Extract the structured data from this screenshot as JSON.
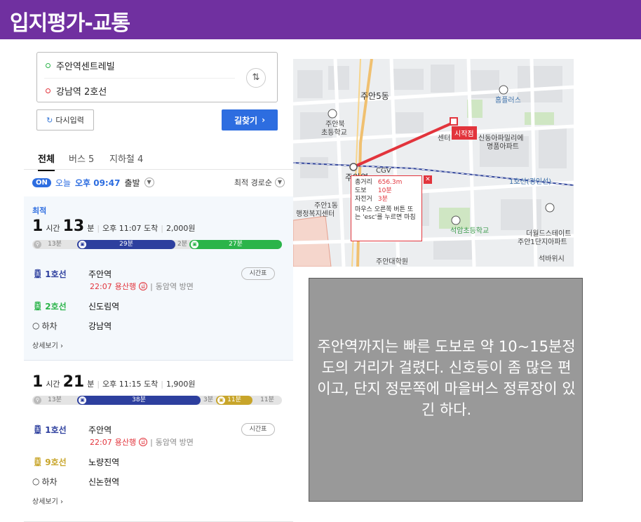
{
  "page": {
    "title": "입지평가-교통"
  },
  "search": {
    "origin": "주안역센트레빌",
    "destination": "강남역 2호선",
    "reset_label": "다시입력",
    "find_label": "길찾기"
  },
  "tabs": [
    {
      "label": "전체"
    },
    {
      "label": "버스 5"
    },
    {
      "label": "지하철 4"
    }
  ],
  "depart": {
    "on_badge": "ON",
    "today": "오늘",
    "time": "오후 09:47",
    "suffix": "출발",
    "sort_label": "최적 경로순"
  },
  "routes": [
    {
      "badge": "최적",
      "hours": "1",
      "hours_unit": "시간",
      "minutes": "13",
      "minutes_unit": "분",
      "arrival": "오후 11:07 도착",
      "fare": "2,000원",
      "segments": [
        {
          "label": "13분",
          "mode": "walk"
        },
        {
          "label": "29분",
          "mode": "line1"
        },
        {
          "label": "2분",
          "mode": "walk"
        },
        {
          "label": "27분",
          "mode": "line2"
        }
      ],
      "legs": [
        {
          "line": "1호선",
          "station": "주안역",
          "color": "#2d3f9e",
          "sub_time": "22:07",
          "sub_dir": "용산행",
          "sub_next": "동암역 방면",
          "sub_badge": "급",
          "timetable": "시간표"
        },
        {
          "line": "2호선",
          "station": "신도림역",
          "color": "#2bb44a"
        },
        {
          "line": "하차",
          "station": "강남역",
          "color": "#333333"
        }
      ],
      "detail": "상세보기"
    },
    {
      "hours": "1",
      "hours_unit": "시간",
      "minutes": "21",
      "minutes_unit": "분",
      "arrival": "오후 11:15 도착",
      "fare": "1,900원",
      "segments": [
        {
          "label": "13분",
          "mode": "walk"
        },
        {
          "label": "38분",
          "mode": "line1"
        },
        {
          "label": "3분",
          "mode": "walk"
        },
        {
          "label": "11분",
          "mode": "line9"
        },
        {
          "label": "11분",
          "mode": "walk"
        }
      ],
      "legs": [
        {
          "line": "1호선",
          "station": "주안역",
          "color": "#2d3f9e",
          "sub_time": "22:07",
          "sub_dir": "용산행",
          "sub_next": "동암역 방면",
          "sub_badge": "급",
          "timetable": "시간표"
        },
        {
          "line": "9호선",
          "station": "노량진역",
          "color": "#c8a52a"
        },
        {
          "line": "하차",
          "station": "신논현역",
          "color": "#333333"
        }
      ],
      "detail": "상세보기"
    }
  ],
  "map": {
    "labels": {
      "dong": "주안5동",
      "homeplus": "홈플러스",
      "school1_a": "주안북",
      "school1_b": "초등학교",
      "apt1_a": "신동아파밀리에",
      "apt1_b": "명품아파트",
      "cgv": "CGV",
      "station": "주안역",
      "line": "1호선(경인선)",
      "center_a": "주안1동",
      "center_b": "행정복지센터",
      "school2": "석암초등학교",
      "apt2_a": "더월드스테이트",
      "apt2_b": "주안1단지아파트",
      "univ": "주안대학원",
      "stone": "석바위시",
      "center_c": "센터"
    },
    "start_tag": "시작점",
    "info": {
      "total_label": "총거리",
      "total_value": "656.3m",
      "walk_label": "도보",
      "walk_value": "10분",
      "bike_label": "자전거",
      "bike_value": "3분",
      "hint": "마우스 오른쪽 버튼 또는 'esc'를 누르면 마침"
    }
  },
  "note": {
    "text": "주안역까지는 빠른 도보로 약 10~15분정도의 거리가 걸렸다. 신호등이 좀 많은 편이고, 단지 정문쪽에 마을버스 정류장이 있긴 하다."
  },
  "colors": {
    "title_bg": "#7030a0",
    "primary_blue": "#2d6de0",
    "line1": "#2d3f9e",
    "line2": "#2bb44a",
    "line9": "#c8a52a",
    "red": "#e2343c",
    "note_bg": "#999999"
  }
}
